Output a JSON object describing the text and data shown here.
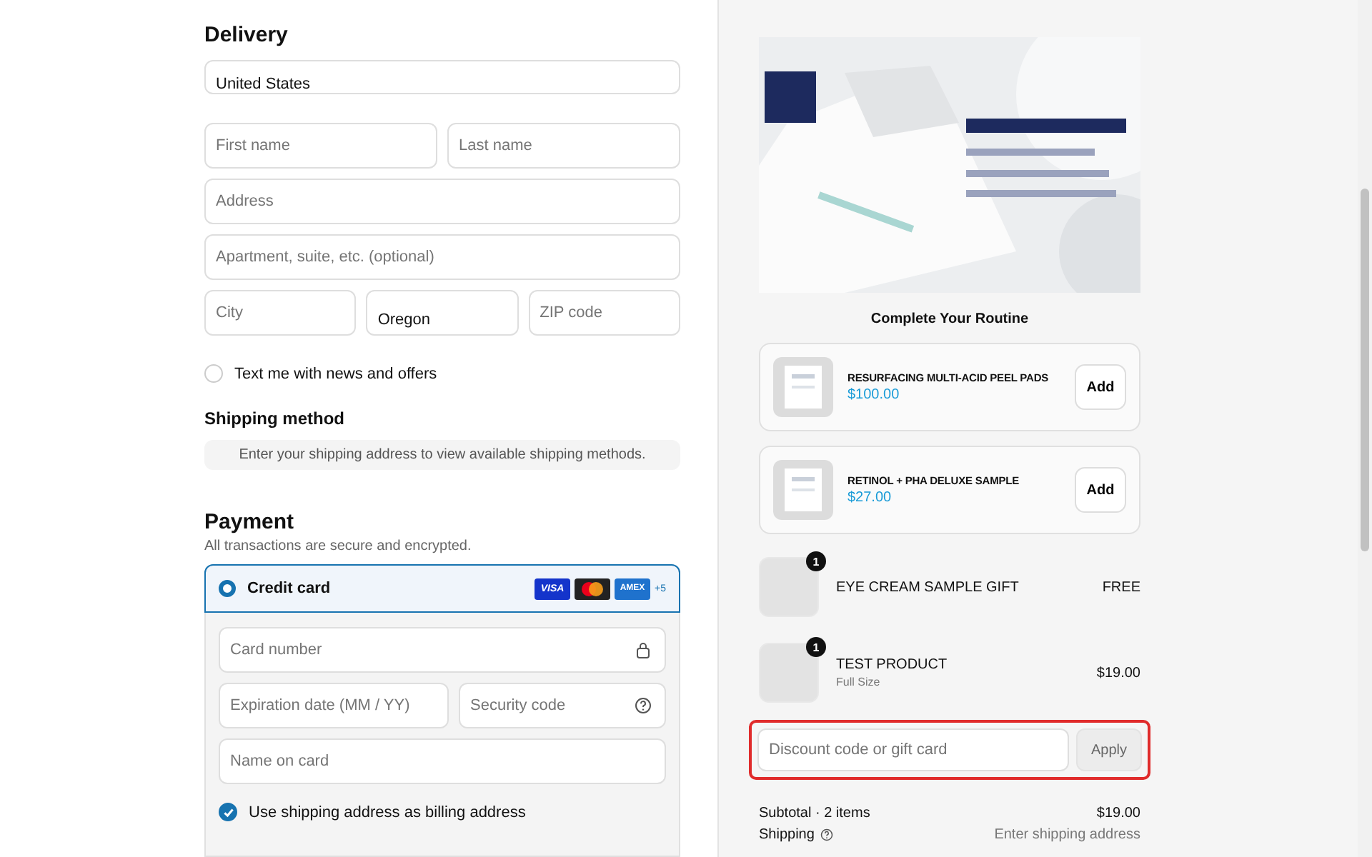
{
  "delivery": {
    "heading": "Delivery",
    "country": {
      "value": "United States"
    },
    "rows": [
      [
        {
          "placeholder": "First name"
        },
        {
          "placeholder": "Last name"
        }
      ],
      [
        {
          "placeholder": "Address"
        }
      ],
      [
        {
          "placeholder": "Apartment, suite, etc. (optional)"
        }
      ],
      [
        {
          "placeholder": "City"
        },
        {
          "value": "Oregon"
        },
        {
          "placeholder": "ZIP code"
        }
      ]
    ],
    "news_checkbox": {
      "label": "Text me with news and offers",
      "checked": false
    }
  },
  "shipping_method": {
    "heading": "Shipping method",
    "notice": "Enter your shipping address to view available shipping methods."
  },
  "payment": {
    "heading": "Payment",
    "subtitle": "All transactions are secure and encrypted.",
    "method": {
      "label": "Credit card",
      "selected": true,
      "card_brands": [
        "VISA",
        "AMEX"
      ],
      "more": "+5"
    },
    "card_number": {
      "placeholder": "Card number"
    },
    "expiration": {
      "placeholder": "Expiration date (MM / YY)"
    },
    "security_code": {
      "placeholder": "Security code"
    },
    "name_on_card": {
      "placeholder": "Name on card"
    },
    "billing_checkbox": {
      "label": "Use shipping address as billing address",
      "checked": true
    }
  },
  "summary": {
    "routine_heading": "Complete Your Routine",
    "upsells": [
      {
        "name": "RESURFACING MULTI-ACID PEEL PADS",
        "price": "$100.00",
        "button": "Add"
      },
      {
        "name": "RETINOL + PHA DELUXE SAMPLE",
        "price": "$27.00",
        "button": "Add"
      }
    ],
    "items": [
      {
        "quantity": "1",
        "name": "EYE CREAM SAMPLE GIFT",
        "price": "FREE"
      },
      {
        "quantity": "1",
        "name": "TEST PRODUCT",
        "variant": "Full Size",
        "price": "$19.00"
      }
    ],
    "discount": {
      "placeholder": "Discount code or gift card",
      "button": "Apply"
    },
    "subtotal": {
      "label": "Subtotal · 2 items",
      "value": "$19.00"
    },
    "shipping": {
      "label": "Shipping",
      "value": "Enter shipping address"
    }
  }
}
